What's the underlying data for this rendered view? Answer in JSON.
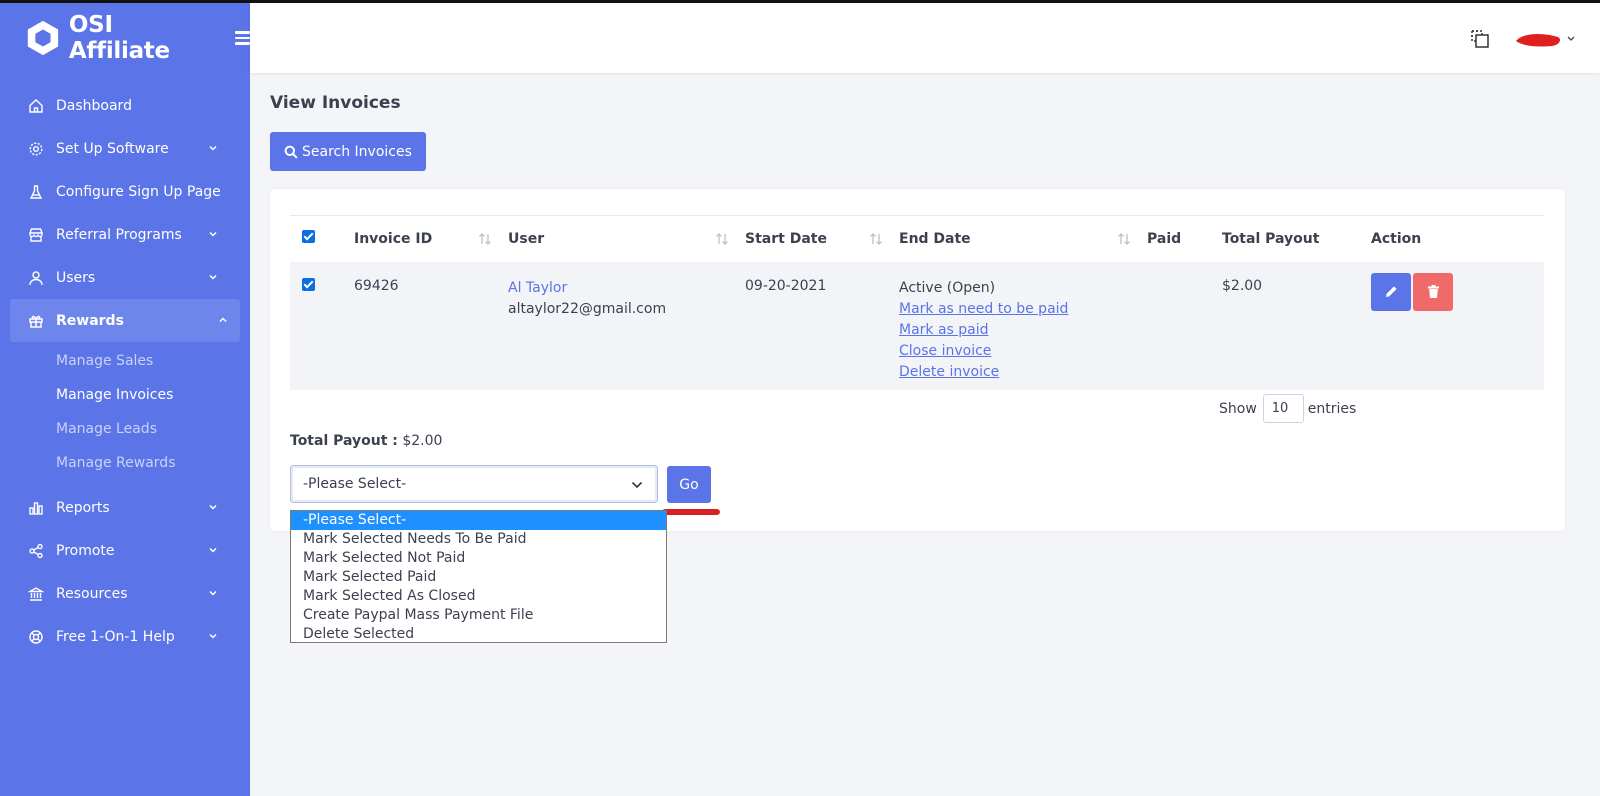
{
  "brand": {
    "name": "OSI Affiliate"
  },
  "nav": {
    "items": [
      {
        "label": "Dashboard"
      },
      {
        "label": "Set Up Software"
      },
      {
        "label": "Configure Sign Up Page"
      },
      {
        "label": "Referral Programs"
      },
      {
        "label": "Users"
      },
      {
        "label": "Rewards"
      },
      {
        "label": "Reports"
      },
      {
        "label": "Promote"
      },
      {
        "label": "Resources"
      },
      {
        "label": "Free 1-On-1 Help"
      }
    ],
    "rewards_sub": [
      {
        "label": "Manage Sales"
      },
      {
        "label": "Manage Invoices"
      },
      {
        "label": "Manage Leads"
      },
      {
        "label": "Manage Rewards"
      }
    ]
  },
  "page": {
    "title": "View Invoices",
    "search_button": "Search Invoices"
  },
  "table": {
    "headers": [
      "Invoice ID",
      "User",
      "Start Date",
      "End Date",
      "Paid",
      "Total Payout",
      "Action"
    ],
    "rows": [
      {
        "invoice_id": "69426",
        "user_name": "Al Taylor",
        "user_email": "altaylor22@gmail.com",
        "start_date": "09-20-2021",
        "end_status": "Active (Open)",
        "links": [
          "Mark as need to be paid",
          "Mark as paid",
          "Close invoice",
          "Delete invoice"
        ],
        "paid": "",
        "total_payout": "$2.00"
      }
    ]
  },
  "entries": {
    "show": "Show",
    "value": "10",
    "suffix": "entries"
  },
  "total": {
    "label": "Total Payout :",
    "value": "$2.00"
  },
  "bulk": {
    "selected": "-Please Select-",
    "go": "Go",
    "options": [
      "-Please Select-",
      "Mark Selected Needs To Be Paid",
      "Mark Selected Not Paid",
      "Mark Selected Paid",
      "Mark Selected As Closed",
      "Create Paypal Mass Payment File",
      "Delete Selected"
    ]
  },
  "colors": {
    "sidebar": "#5b74e7",
    "primary": "#5b74e7",
    "danger": "#f06a6a",
    "highlight": "#1e90ff"
  }
}
